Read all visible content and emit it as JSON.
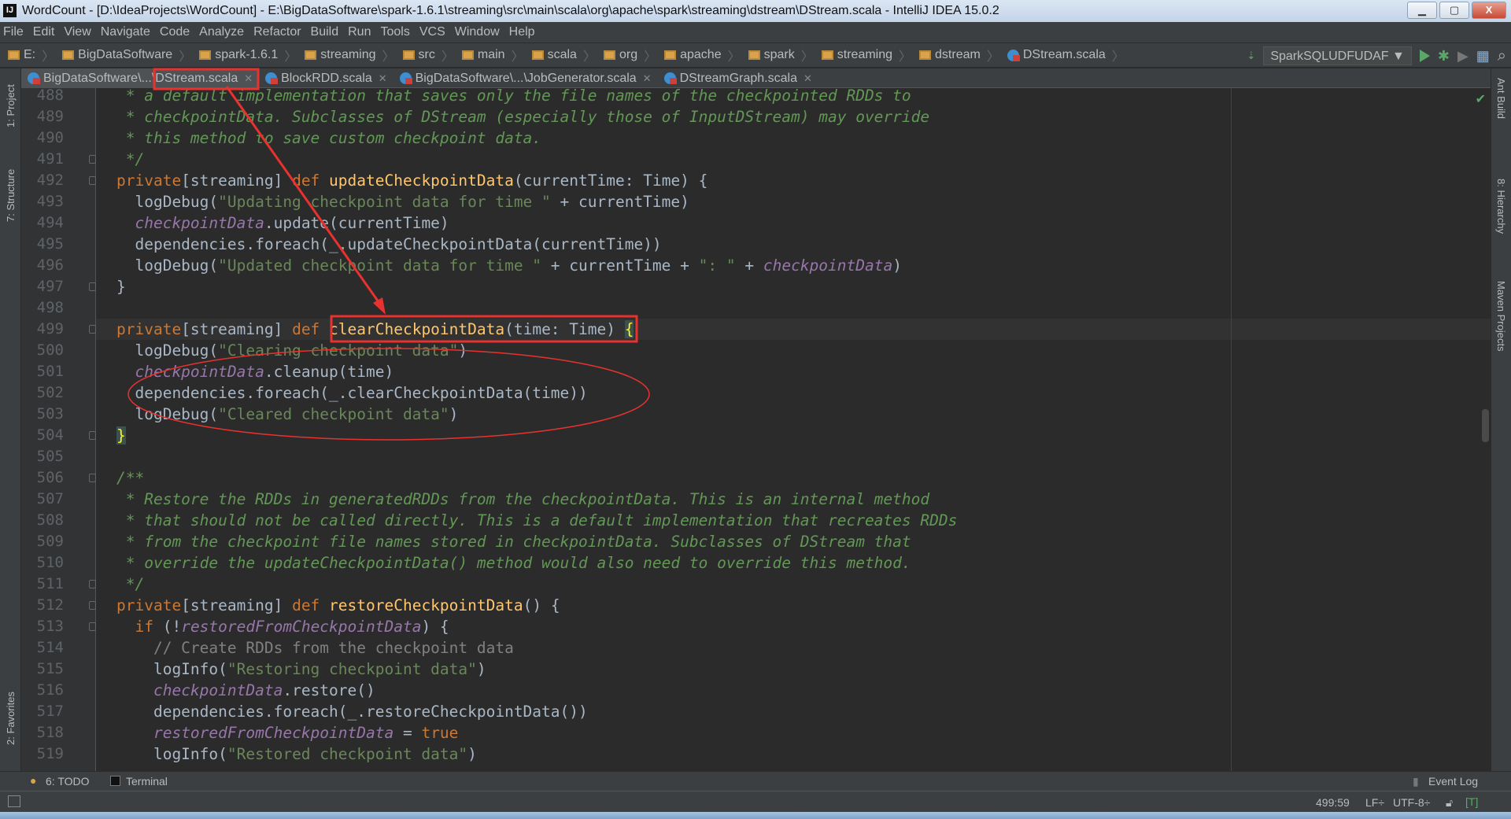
{
  "window": {
    "title": "WordCount - [D:\\IdeaProjects\\WordCount] - E:\\BigDataSoftware\\spark-1.6.1\\streaming\\src\\main\\scala\\org\\apache\\spark\\streaming\\dstream\\DStream.scala - IntelliJ IDEA 15.0.2",
    "app_icon": "IJ",
    "minimize": "▁",
    "maximize": "▢",
    "close": "X"
  },
  "menu": [
    "File",
    "Edit",
    "View",
    "Navigate",
    "Code",
    "Analyze",
    "Refactor",
    "Build",
    "Run",
    "Tools",
    "VCS",
    "Window",
    "Help"
  ],
  "breadcrumbs": [
    "E:",
    "BigDataSoftware",
    "spark-1.6.1",
    "streaming",
    "src",
    "main",
    "scala",
    "org",
    "apache",
    "spark",
    "streaming",
    "dstream",
    "DStream.scala"
  ],
  "run_config": "SparkSQLUDFUDAF ▼",
  "tabs": [
    {
      "label": "BigDataSoftware\\...\\DStream.scala",
      "active": true
    },
    {
      "label": "BlockRDD.scala"
    },
    {
      "label": "BigDataSoftware\\...\\JobGenerator.scala"
    },
    {
      "label": "DStreamGraph.scala"
    }
  ],
  "left_tools": [
    "1: Project",
    "7: Structure",
    "2: Favorites"
  ],
  "right_tools": [
    "Ant Build",
    "8: Hierarchy",
    "Maven Projects"
  ],
  "current_line": 499,
  "colors": {
    "background": "#2b2b2b",
    "keyword": "#cc7832",
    "method": "#ffc66d",
    "string": "#6a8759",
    "doc_comment": "#629755",
    "field": "#9876aa",
    "annotation": "#e8322f"
  },
  "code": [
    {
      "n": 488,
      "t": [
        [
          "doc",
          " * a default implementation that saves only the file names of the checkpointed RDDs to"
        ]
      ]
    },
    {
      "n": 489,
      "t": [
        [
          "doc",
          " * checkpointData. Subclasses of DStream (especially those of InputDStream) may override"
        ]
      ]
    },
    {
      "n": 490,
      "t": [
        [
          "doc",
          " * this method to save custom checkpoint data."
        ]
      ]
    },
    {
      "n": 491,
      "t": [
        [
          "doc",
          " */"
        ]
      ]
    },
    {
      "n": 492,
      "t": [
        [
          "kw",
          "private"
        ],
        [
          "tx",
          "[streaming] "
        ],
        [
          "kw",
          "def "
        ],
        [
          "fn",
          "updateCheckpointData"
        ],
        [
          "tx",
          "(currentTime: Time) {"
        ]
      ]
    },
    {
      "n": 493,
      "t": [
        [
          "tx",
          "  logDebug("
        ],
        [
          "str",
          "\"Updating checkpoint data for time \""
        ],
        [
          "tx",
          " + currentTime)"
        ]
      ]
    },
    {
      "n": 494,
      "t": [
        [
          "tx",
          "  "
        ],
        [
          "pur",
          "checkpointData"
        ],
        [
          "tx",
          ".update(currentTime)"
        ]
      ]
    },
    {
      "n": 495,
      "t": [
        [
          "tx",
          "  dependencies.foreach(_.updateCheckpointData(currentTime))"
        ]
      ]
    },
    {
      "n": 496,
      "t": [
        [
          "tx",
          "  logDebug("
        ],
        [
          "str",
          "\"Updated checkpoint data for time \""
        ],
        [
          "tx",
          " + currentTime + "
        ],
        [
          "str",
          "\": \""
        ],
        [
          "tx",
          " + "
        ],
        [
          "pur",
          "checkpointData"
        ],
        [
          "tx",
          ")"
        ]
      ]
    },
    {
      "n": 497,
      "t": [
        [
          "tx",
          "}"
        ]
      ]
    },
    {
      "n": 498,
      "t": []
    },
    {
      "n": 499,
      "t": [
        [
          "kw",
          "private"
        ],
        [
          "tx",
          "[streaming] "
        ],
        [
          "kw",
          "def "
        ],
        [
          "fn",
          "clearCheckpointData"
        ],
        [
          "tx",
          "(time: Time) "
        ],
        [
          "brace",
          "{"
        ]
      ]
    },
    {
      "n": 500,
      "t": [
        [
          "tx",
          "  logDebug("
        ],
        [
          "str",
          "\"Clearing checkpoint data\""
        ],
        [
          "tx",
          ")"
        ]
      ]
    },
    {
      "n": 501,
      "t": [
        [
          "tx",
          "  "
        ],
        [
          "pur",
          "checkpointData"
        ],
        [
          "tx",
          ".cleanup(time)"
        ]
      ]
    },
    {
      "n": 502,
      "t": [
        [
          "tx",
          "  dependencies.foreach(_.clearCheckpointData(time))"
        ]
      ]
    },
    {
      "n": 503,
      "t": [
        [
          "tx",
          "  logDebug("
        ],
        [
          "str",
          "\"Cleared checkpoint data\""
        ],
        [
          "tx",
          ")"
        ]
      ]
    },
    {
      "n": 504,
      "t": [
        [
          "brace",
          "}"
        ]
      ]
    },
    {
      "n": 505,
      "t": []
    },
    {
      "n": 506,
      "t": [
        [
          "doc",
          "/**"
        ]
      ]
    },
    {
      "n": 507,
      "t": [
        [
          "doc",
          " * Restore the RDDs in generatedRDDs from the checkpointData. This is an internal method"
        ]
      ]
    },
    {
      "n": 508,
      "t": [
        [
          "doc",
          " * that should not be called directly. This is a default implementation that recreates RDDs"
        ]
      ]
    },
    {
      "n": 509,
      "t": [
        [
          "doc",
          " * from the checkpoint file names stored in checkpointData. Subclasses of DStream that"
        ]
      ]
    },
    {
      "n": 510,
      "t": [
        [
          "doc",
          " * override the updateCheckpointData() method would also need to override this method."
        ]
      ]
    },
    {
      "n": 511,
      "t": [
        [
          "doc",
          " */"
        ]
      ]
    },
    {
      "n": 512,
      "t": [
        [
          "kw",
          "private"
        ],
        [
          "tx",
          "[streaming] "
        ],
        [
          "kw",
          "def "
        ],
        [
          "fn",
          "restoreCheckpointData"
        ],
        [
          "tx",
          "() {"
        ]
      ]
    },
    {
      "n": 513,
      "t": [
        [
          "tx",
          "  "
        ],
        [
          "kw",
          "if "
        ],
        [
          "tx",
          "(!"
        ],
        [
          "pur",
          "restoredFromCheckpointData"
        ],
        [
          "tx",
          ") {"
        ]
      ]
    },
    {
      "n": 514,
      "t": [
        [
          "cmt",
          "    // Create RDDs from the checkpoint data"
        ]
      ]
    },
    {
      "n": 515,
      "t": [
        [
          "tx",
          "    logInfo("
        ],
        [
          "str",
          "\"Restoring checkpoint data\""
        ],
        [
          "tx",
          ")"
        ]
      ]
    },
    {
      "n": 516,
      "t": [
        [
          "tx",
          "    "
        ],
        [
          "pur",
          "checkpointData"
        ],
        [
          "tx",
          ".restore()"
        ]
      ]
    },
    {
      "n": 517,
      "t": [
        [
          "tx",
          "    dependencies.foreach(_.restoreCheckpointData())"
        ]
      ]
    },
    {
      "n": 518,
      "t": [
        [
          "tx",
          "    "
        ],
        [
          "pur",
          "restoredFromCheckpointData"
        ],
        [
          "tx",
          " = "
        ],
        [
          "kw",
          "true"
        ]
      ]
    },
    {
      "n": 519,
      "t": [
        [
          "tx",
          "    logInfo("
        ],
        [
          "str",
          "\"Restored checkpoint data\""
        ],
        [
          "tx",
          ")"
        ]
      ]
    }
  ],
  "bottom_tools": {
    "todo": "6: TODO",
    "terminal": "Terminal",
    "event_log": "Event Log"
  },
  "status": {
    "position": "499:59",
    "line_sep": "LF÷",
    "encoding": "UTF-8÷"
  }
}
